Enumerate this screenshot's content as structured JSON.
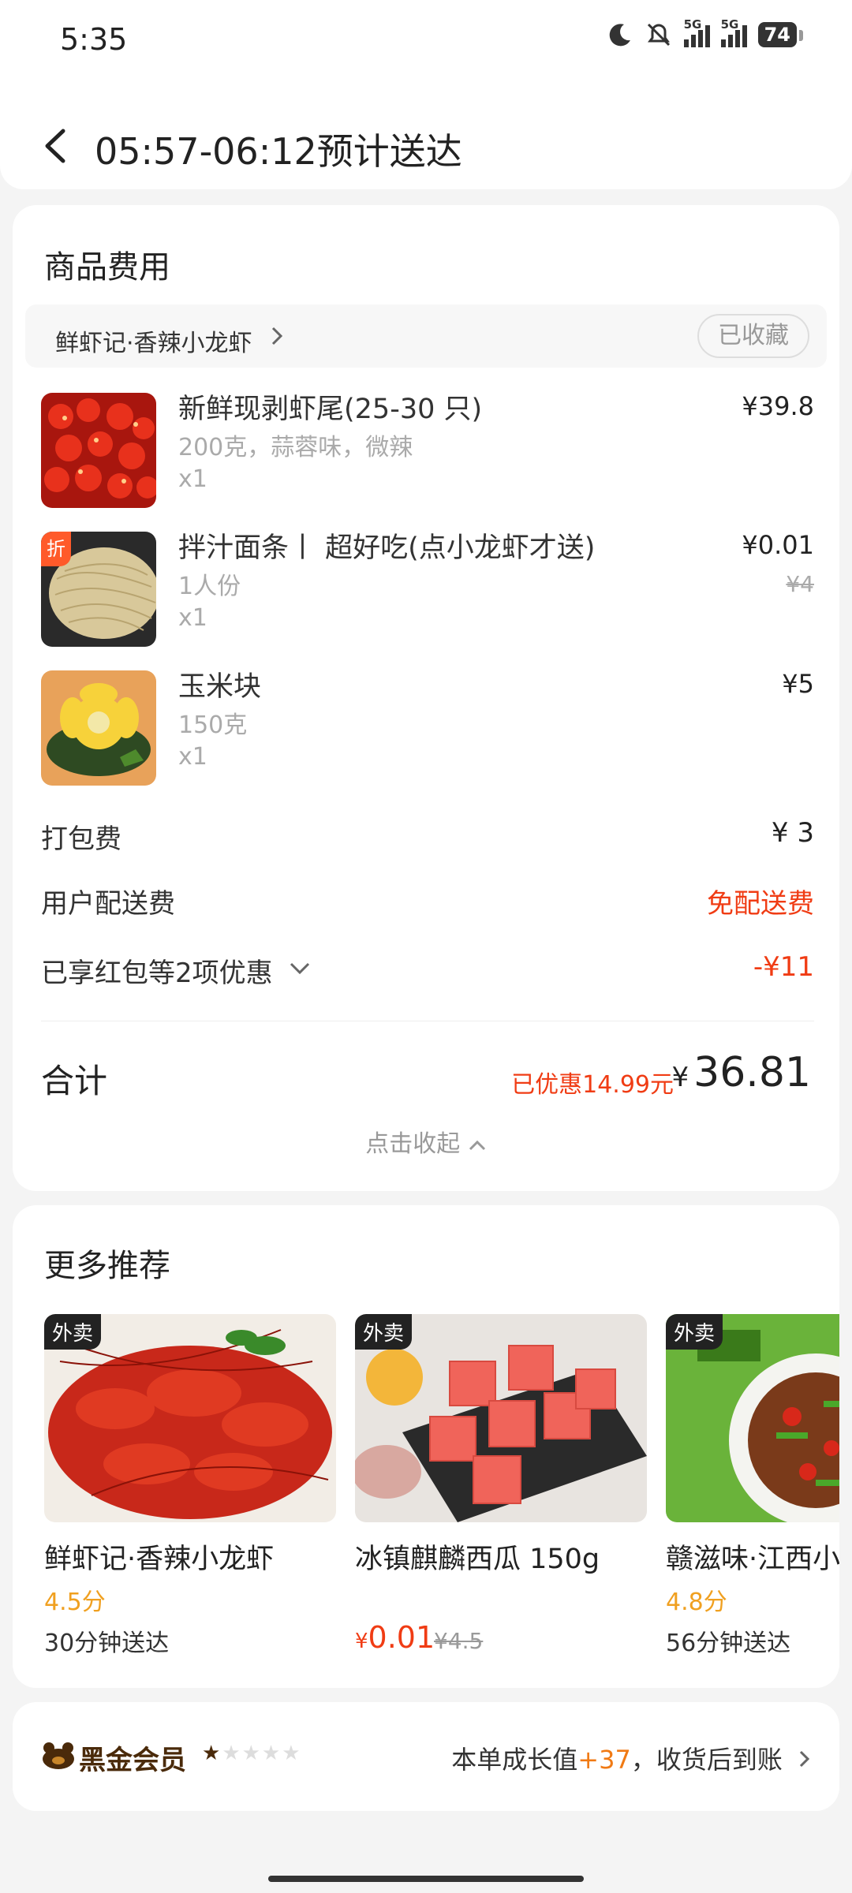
{
  "status_bar": {
    "time": "5:35",
    "network_1": "5G",
    "network_2": "5G",
    "battery": "74"
  },
  "header": {
    "title": "05:57-06:12预计送达"
  },
  "fee_section": {
    "title": "商品费用",
    "shop_name": "鲜虾记·香辣小龙虾",
    "fav_label": "已收藏",
    "items": [
      {
        "name": "新鲜现剥虾尾(25-30 只)",
        "spec": "200克，蒜蓉味，微辣",
        "qty": "x1",
        "price": "¥39.8"
      },
      {
        "name": "拌汁面条丨 超好吃(点小龙虾才送)",
        "spec": "1人份",
        "qty": "x1",
        "price": "¥0.01",
        "original_price": "¥4",
        "badge": "折"
      },
      {
        "name": "玉米块",
        "spec": "150克",
        "qty": "x1",
        "price": "¥5"
      }
    ],
    "packing": {
      "label": "打包费",
      "value": "¥ 3"
    },
    "delivery": {
      "label": "用户配送费",
      "value": "免配送费"
    },
    "discount": {
      "label": "已享红包等2项优惠",
      "value": "-¥11"
    },
    "total": {
      "label": "合计",
      "saved": "已优惠14.99元",
      "currency": "¥",
      "amount": "36.81"
    },
    "collapse_label": "点击收起"
  },
  "recommend": {
    "title": "更多推荐",
    "tag": "外卖",
    "items": [
      {
        "name": "鲜虾记·香辣小龙虾",
        "score": "4.5分",
        "time": "30分钟送达"
      },
      {
        "name": "冰镇麒麟西瓜 150g",
        "price": "0.01",
        "price_currency": "¥",
        "original_price": "¥4.5"
      },
      {
        "name": "赣滋味·江西小",
        "score": "4.8分",
        "time": "56分钟送达"
      }
    ]
  },
  "vip": {
    "label": "黑金会员",
    "stars": "★★★★★",
    "growth_prefix": "本单成长值",
    "growth_value": "+37",
    "growth_suffix": "，收货后到账"
  },
  "colors": {
    "accent_red": "#f03c14",
    "score_orange": "#f0a020",
    "vip_brown": "#4a2a0a"
  }
}
